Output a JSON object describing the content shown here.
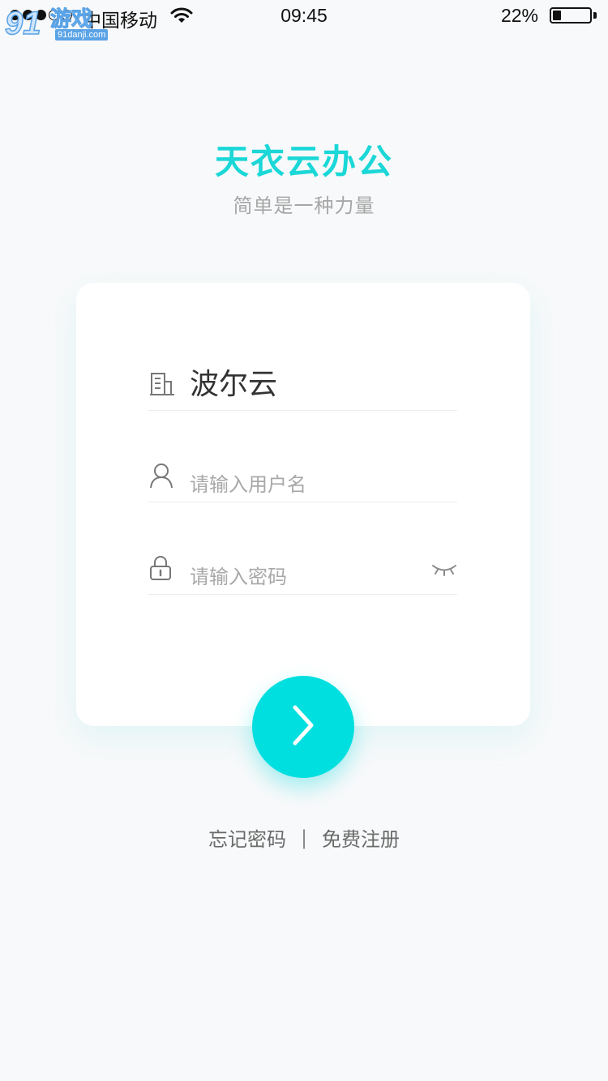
{
  "status_bar": {
    "carrier": "中国移动",
    "time": "09:45",
    "battery_percent_text": "22%",
    "battery_level": 0.22,
    "signal_strength": 3,
    "signal_max": 5
  },
  "watermark": {
    "text": "91danji.com"
  },
  "header": {
    "title": "天衣云办公",
    "slogan": "简单是一种力量"
  },
  "login_form": {
    "company": {
      "icon": "building-icon",
      "value": "波尔云"
    },
    "username": {
      "icon": "user-icon",
      "placeholder": "请输入用户名"
    },
    "password": {
      "icon": "lock-icon",
      "placeholder": "请输入密码",
      "toggle_icon": "eye-closed-icon"
    },
    "submit_icon": "chevron-right-icon"
  },
  "links": {
    "forgot_password": "忘记密码",
    "divider": "|",
    "register": "免费注册"
  },
  "colors": {
    "accent": "#00dfe0",
    "title": "#1bd7d7",
    "background": "#f8f9fa"
  }
}
